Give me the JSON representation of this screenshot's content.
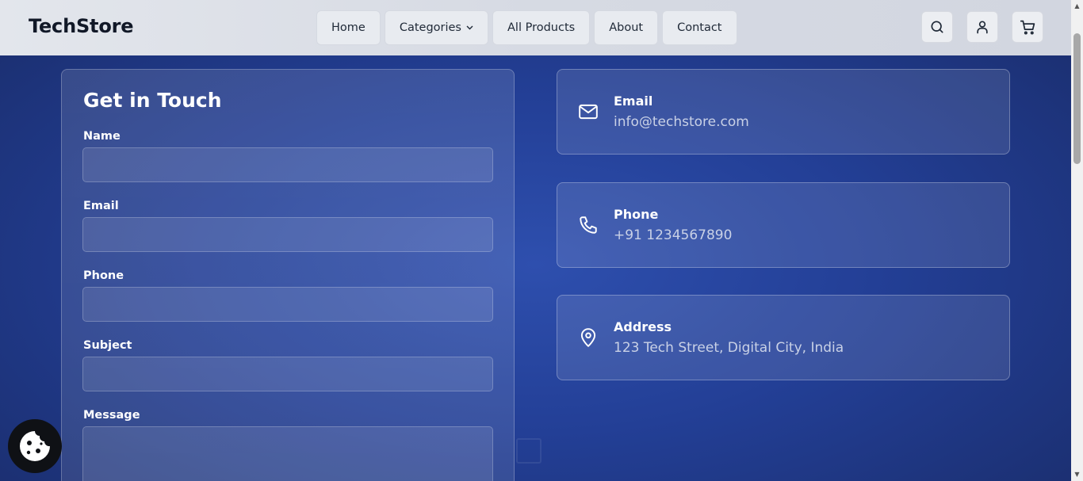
{
  "header": {
    "logo": "TechStore",
    "nav": [
      {
        "label": "Home"
      },
      {
        "label": "Categories"
      },
      {
        "label": "All Products"
      },
      {
        "label": "About"
      },
      {
        "label": "Contact"
      }
    ],
    "icons": [
      "search-icon",
      "user-icon",
      "cart-icon"
    ]
  },
  "form": {
    "title": "Get in Touch",
    "fields": [
      {
        "label": "Name",
        "value": "",
        "placeholder": ""
      },
      {
        "label": "Email",
        "value": "",
        "placeholder": ""
      },
      {
        "label": "Phone",
        "value": "",
        "placeholder": ""
      },
      {
        "label": "Subject",
        "value": "",
        "placeholder": ""
      },
      {
        "label": "Message",
        "value": "",
        "placeholder": ""
      }
    ]
  },
  "contact_info": [
    {
      "icon": "mail-icon",
      "title": "Email",
      "value": "info@techstore.com"
    },
    {
      "icon": "phone-icon",
      "title": "Phone",
      "value": "+91 1234567890"
    },
    {
      "icon": "location-pin-icon",
      "title": "Address",
      "value": "123 Tech Street, Digital City, India"
    }
  ],
  "colors": {
    "background": "#233f96",
    "header": "#dfe3ea",
    "text_primary": "#ffffff",
    "text_muted": "#c9d1e6"
  }
}
